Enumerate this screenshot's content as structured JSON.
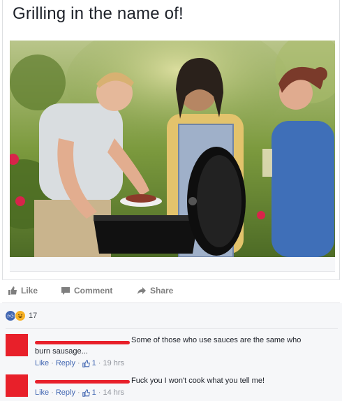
{
  "post": {
    "title": "Grilling in the name of!"
  },
  "actions": {
    "like": "Like",
    "comment": "Comment",
    "share": "Share"
  },
  "reactions": {
    "count": "17",
    "icons": [
      "like-icon",
      "haha-icon"
    ]
  },
  "comments": [
    {
      "line1": "Some of those who use sauces are the same who",
      "line2": "burn sausage...",
      "like": "Like",
      "reply": "Reply",
      "likes": "1",
      "time": "19 hrs"
    },
    {
      "line1": "Fuck you I won't cook what you tell me!",
      "like": "Like",
      "reply": "Reply",
      "likes": "1",
      "time": "14 hrs"
    }
  ],
  "colors": {
    "accent": "#4267b2",
    "redaction": "#e8202a",
    "meta": "#90949c"
  }
}
